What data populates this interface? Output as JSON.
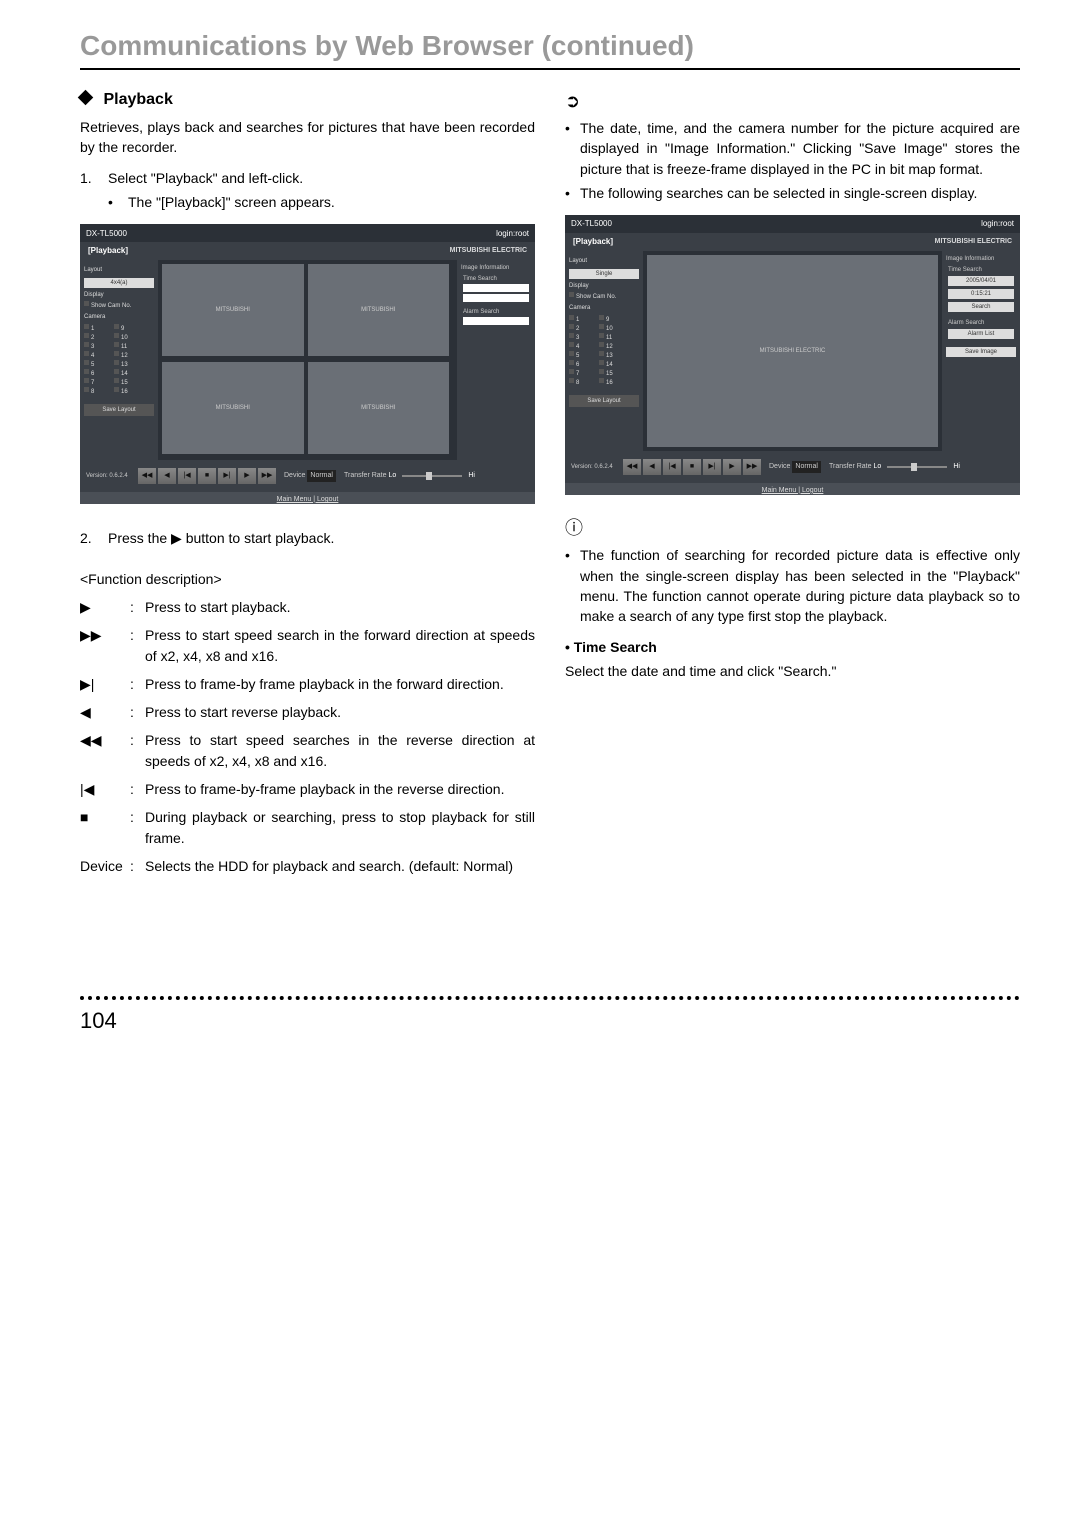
{
  "header": {
    "title": "Communications by Web Browser (continued)"
  },
  "left": {
    "section_title": "Playback",
    "intro": "Retrieves, plays back and searches for pictures that have been recorded by the recorder.",
    "step1_num": "1.",
    "step1_text": "Select \"Playback\" and left-click.",
    "step1_bullet_dot": "•",
    "step1_bullet": "The \"[Playback]\" screen appears.",
    "step2_num": "2.",
    "step2_text_a": "Press the ",
    "step2_icon": "▶",
    "step2_text_b": " button to start playback.",
    "funcdesc_title": "<Function description>",
    "funcs": [
      {
        "icon": "▶",
        "text": "Press to start playback."
      },
      {
        "icon": "▶▶",
        "text": "Press to start speed search in the forward direction at speeds of x2, x4, x8 and x16."
      },
      {
        "icon": "▶|",
        "text": "Press to frame-by frame playback in the forward direction."
      },
      {
        "icon": "◀",
        "text": "Press to start reverse playback."
      },
      {
        "icon": "◀◀",
        "text": "Press to start speed searches in the reverse direction at speeds of x2, x4, x8 and x16."
      },
      {
        "icon": "|◀",
        "text": "Press to frame-by-frame playback in the reverse direction."
      },
      {
        "icon": "■",
        "text": "During playback or searching, press to stop playback for still frame."
      },
      {
        "icon_text": "Device",
        "text": "Selects the HDD for playback and search. (default: Normal)"
      }
    ]
  },
  "right": {
    "tip_icon": "➲",
    "tips": [
      "The date, time, and the camera number for the picture acquired are displayed in \"Image Information.\" Clicking \"Save Image\" stores the picture that is freeze-frame displayed in the PC in bit map format.",
      "The following searches can be selected in single-screen display."
    ],
    "note_icon": "ⓘ",
    "note_text": "The function of searching for recorded picture data is effective only when the single-screen display has been selected in the \"Playback\" menu. The function cannot operate during picture data playback so to make a search of any type first stop the playback.",
    "time_search_head": "• Time Search",
    "time_search_text": "Select the date and time and click \"Search.\""
  },
  "screenshot": {
    "model": "DX-TL5000",
    "login": "login:root",
    "title": "[Playback]",
    "brand": "MITSUBISHI ELECTRIC",
    "layout_label": "Layout",
    "layout_value": "4x4(a)",
    "single_value": "Single",
    "display_label": "Display",
    "show_cam_label": "Show Cam No.",
    "camera_label": "Camera",
    "cams": [
      "1",
      "9",
      "2",
      "10",
      "3",
      "11",
      "4",
      "12",
      "5",
      "13",
      "6",
      "14",
      "7",
      "15",
      "8",
      "16"
    ],
    "save_layout": "Save Layout",
    "image_info": "Image Information",
    "time_search_label": "Time Search",
    "time_date": "2005/04/01",
    "time_time": "0:15:21",
    "search_btn": "Search",
    "alarm_search_label": "Alarm Search",
    "alarm_btn": "Alarm List",
    "save_image_btn": "Save Image",
    "version": "Version: 0.6.2.4",
    "controls": [
      "◀◀",
      "◀",
      "|◀",
      "■",
      "▶|",
      "▶",
      "▶▶"
    ],
    "device_label": "Device",
    "device_value": "Normal",
    "rate_label": "Transfer Rate",
    "rate_lo": "Lo",
    "rate_hi": "Hi",
    "footer": "Main Menu | Logout",
    "vid_brand": "MITSUBISHI"
  },
  "footer": {
    "page": "104"
  }
}
